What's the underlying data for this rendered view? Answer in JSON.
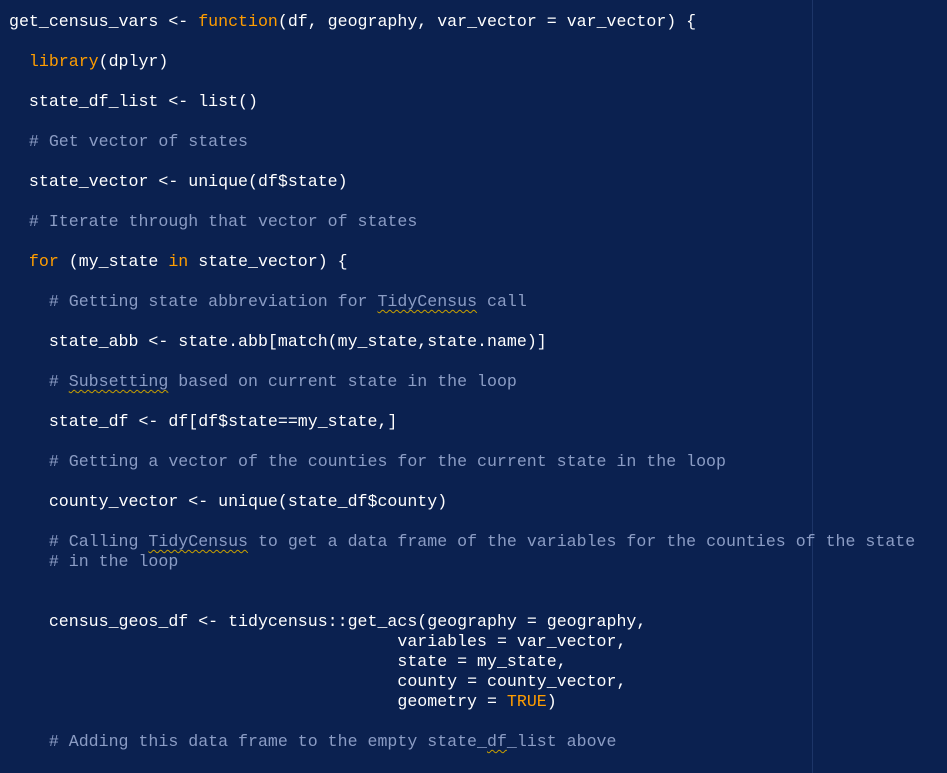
{
  "editor": {
    "theme_colors": {
      "background": "#0b2150",
      "text": "#ffffff",
      "keyword": "#ff9d00",
      "comment": "#8b9cc4",
      "constant": "#ff9d00",
      "squiggle": "#c8a000"
    },
    "lines": [
      {
        "segments": [
          {
            "text": "get_census_vars ",
            "kind": "plain"
          },
          {
            "text": "<-",
            "kind": "plain"
          },
          {
            "text": " ",
            "kind": "plain"
          },
          {
            "text": "function",
            "kind": "kw"
          },
          {
            "text": "(df, geography, var_vector ",
            "kind": "plain"
          },
          {
            "text": "=",
            "kind": "plain"
          },
          {
            "text": " var_vector) {",
            "kind": "plain"
          }
        ]
      },
      {
        "segments": []
      },
      {
        "segments": [
          {
            "text": "  ",
            "kind": "plain"
          },
          {
            "text": "library",
            "kind": "kw"
          },
          {
            "text": "(dplyr)",
            "kind": "plain"
          }
        ]
      },
      {
        "segments": []
      },
      {
        "segments": [
          {
            "text": "  state_df_list ",
            "kind": "plain"
          },
          {
            "text": "<-",
            "kind": "plain"
          },
          {
            "text": " list()",
            "kind": "plain"
          }
        ]
      },
      {
        "segments": []
      },
      {
        "segments": [
          {
            "text": "  # Get vector of states",
            "kind": "comment"
          }
        ]
      },
      {
        "segments": []
      },
      {
        "segments": [
          {
            "text": "  state_vector ",
            "kind": "plain"
          },
          {
            "text": "<-",
            "kind": "plain"
          },
          {
            "text": " unique(df$state)",
            "kind": "plain"
          }
        ]
      },
      {
        "segments": []
      },
      {
        "segments": [
          {
            "text": "  # Iterate through that vector of states",
            "kind": "comment"
          }
        ]
      },
      {
        "segments": []
      },
      {
        "segments": [
          {
            "text": "  ",
            "kind": "plain"
          },
          {
            "text": "for",
            "kind": "kw"
          },
          {
            "text": " (my_state ",
            "kind": "plain"
          },
          {
            "text": "in",
            "kind": "kw"
          },
          {
            "text": " state_vector) {",
            "kind": "plain"
          }
        ]
      },
      {
        "segments": []
      },
      {
        "segments": [
          {
            "text": "    # Getting state abbreviation for ",
            "kind": "comment"
          },
          {
            "text": "TidyCensus",
            "kind": "comment-squiggle"
          },
          {
            "text": " call",
            "kind": "comment"
          }
        ]
      },
      {
        "segments": []
      },
      {
        "segments": [
          {
            "text": "    state_abb ",
            "kind": "plain"
          },
          {
            "text": "<-",
            "kind": "plain"
          },
          {
            "text": " state.abb[match(my_state,state.name)]",
            "kind": "plain"
          }
        ]
      },
      {
        "segments": []
      },
      {
        "segments": [
          {
            "text": "    # ",
            "kind": "comment"
          },
          {
            "text": "Subsetting",
            "kind": "comment-squiggle"
          },
          {
            "text": " based on current state in the loop",
            "kind": "comment"
          }
        ]
      },
      {
        "segments": []
      },
      {
        "segments": [
          {
            "text": "    state_df ",
            "kind": "plain"
          },
          {
            "text": "<-",
            "kind": "plain"
          },
          {
            "text": " df[df$state",
            "kind": "plain"
          },
          {
            "text": "==",
            "kind": "plain"
          },
          {
            "text": "my_state,]",
            "kind": "plain"
          }
        ]
      },
      {
        "segments": []
      },
      {
        "segments": [
          {
            "text": "    # Getting a vector of the counties for the current state in the loop",
            "kind": "comment"
          }
        ]
      },
      {
        "segments": []
      },
      {
        "segments": [
          {
            "text": "    county_vector ",
            "kind": "plain"
          },
          {
            "text": "<-",
            "kind": "plain"
          },
          {
            "text": " unique(state_df$county)",
            "kind": "plain"
          }
        ]
      },
      {
        "segments": []
      },
      {
        "segments": [
          {
            "text": "    # Calling ",
            "kind": "comment"
          },
          {
            "text": "TidyCensus",
            "kind": "comment-squiggle"
          },
          {
            "text": " to get a data frame of the variables for the counties of the state",
            "kind": "comment"
          }
        ]
      },
      {
        "segments": [
          {
            "text": "    # in the loop",
            "kind": "comment"
          }
        ]
      },
      {
        "segments": []
      },
      {
        "segments": []
      },
      {
        "segments": [
          {
            "text": "    census_geos_df ",
            "kind": "plain"
          },
          {
            "text": "<-",
            "kind": "plain"
          },
          {
            "text": " tidycensus::get_acs(geography ",
            "kind": "plain"
          },
          {
            "text": "=",
            "kind": "plain"
          },
          {
            "text": " geography,",
            "kind": "plain"
          }
        ]
      },
      {
        "segments": [
          {
            "text": "                                       variables ",
            "kind": "plain"
          },
          {
            "text": "=",
            "kind": "plain"
          },
          {
            "text": " var_vector,",
            "kind": "plain"
          }
        ]
      },
      {
        "segments": [
          {
            "text": "                                       state ",
            "kind": "plain"
          },
          {
            "text": "=",
            "kind": "plain"
          },
          {
            "text": " my_state,",
            "kind": "plain"
          }
        ]
      },
      {
        "segments": [
          {
            "text": "                                       county ",
            "kind": "plain"
          },
          {
            "text": "=",
            "kind": "plain"
          },
          {
            "text": " county_vector,",
            "kind": "plain"
          }
        ]
      },
      {
        "segments": [
          {
            "text": "                                       geometry ",
            "kind": "plain"
          },
          {
            "text": "=",
            "kind": "plain"
          },
          {
            "text": " ",
            "kind": "plain"
          },
          {
            "text": "TRUE",
            "kind": "const"
          },
          {
            "text": ")",
            "kind": "plain"
          }
        ]
      },
      {
        "segments": []
      },
      {
        "segments": [
          {
            "text": "    # Adding this data frame to the empty state_",
            "kind": "comment"
          },
          {
            "text": "df",
            "kind": "comment-squiggle"
          },
          {
            "text": "_list above",
            "kind": "comment"
          }
        ]
      }
    ]
  }
}
